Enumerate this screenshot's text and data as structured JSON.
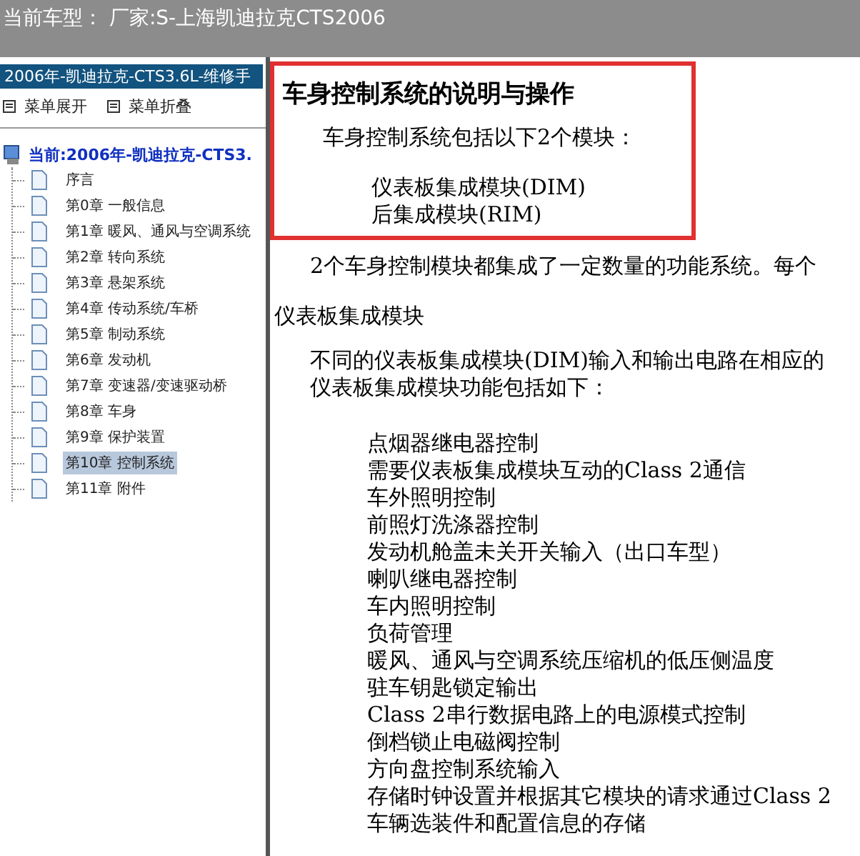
{
  "window": {
    "title": "当前车型： 厂家:S-上海凯迪拉克CTS2006"
  },
  "sidebar": {
    "header": "2006年-凯迪拉克-CTS3.6L-维修手",
    "toolbar": [
      "菜单展开",
      "菜单折叠"
    ],
    "tree": {
      "label": "当前:2006年-凯迪拉克-CTS3.",
      "children": [
        {
          "label": "序言",
          "selected": false
        },
        {
          "label": "第0章 一般信息",
          "selected": false
        },
        {
          "label": "第1章 暖风、通风与空调系统",
          "selected": false
        },
        {
          "label": "第2章 转向系统",
          "selected": false
        },
        {
          "label": "第3章 悬架系统",
          "selected": false
        },
        {
          "label": "第4章 传动系统/车桥",
          "selected": false
        },
        {
          "label": "第5章 制动系统",
          "selected": false
        },
        {
          "label": "第6章 发动机",
          "selected": false
        },
        {
          "label": "第7章 变速器/变速驱动桥",
          "selected": false
        },
        {
          "label": "第8章 车身",
          "selected": false
        },
        {
          "label": "第9章 保护装置",
          "selected": false
        },
        {
          "label": "第10章 控制系统",
          "selected": true
        },
        {
          "label": "第11章 附件",
          "selected": false
        }
      ]
    }
  },
  "document": {
    "title": "车身控制系统的说明与操作",
    "intro": "车身控制系统包括以下2个模块：",
    "modules": [
      "仪表板集成模块(DIM)",
      "后集成模块(RIM)"
    ],
    "paragraph": "2个车身控制模块都集成了一定数量的功能系统。每个",
    "section_heading": "仪表板集成模块",
    "section_text": [
      "不同的仪表板集成模块(DIM)输入和输出电路在相应的",
      "仪表板集成模块功能包括如下："
    ],
    "functions": [
      "点烟器继电器控制",
      "需要仪表板集成模块互动的Class 2通信",
      "车外照明控制",
      "前照灯洗涤器控制",
      "发动机舱盖未关开关输入（出口车型）",
      "喇叭继电器控制",
      "车内照明控制",
      "负荷管理",
      "暖风、通风与空调系统压缩机的低压侧温度",
      "驻车钥匙锁定输出",
      "Class 2串行数据电路上的电源模式控制",
      "倒档锁止电磁阀控制",
      "方向盘控制系统输入",
      "存储时钟设置并根据其它模块的请求通过Class 2",
      "车辆选装件和配置信息的存储"
    ]
  }
}
